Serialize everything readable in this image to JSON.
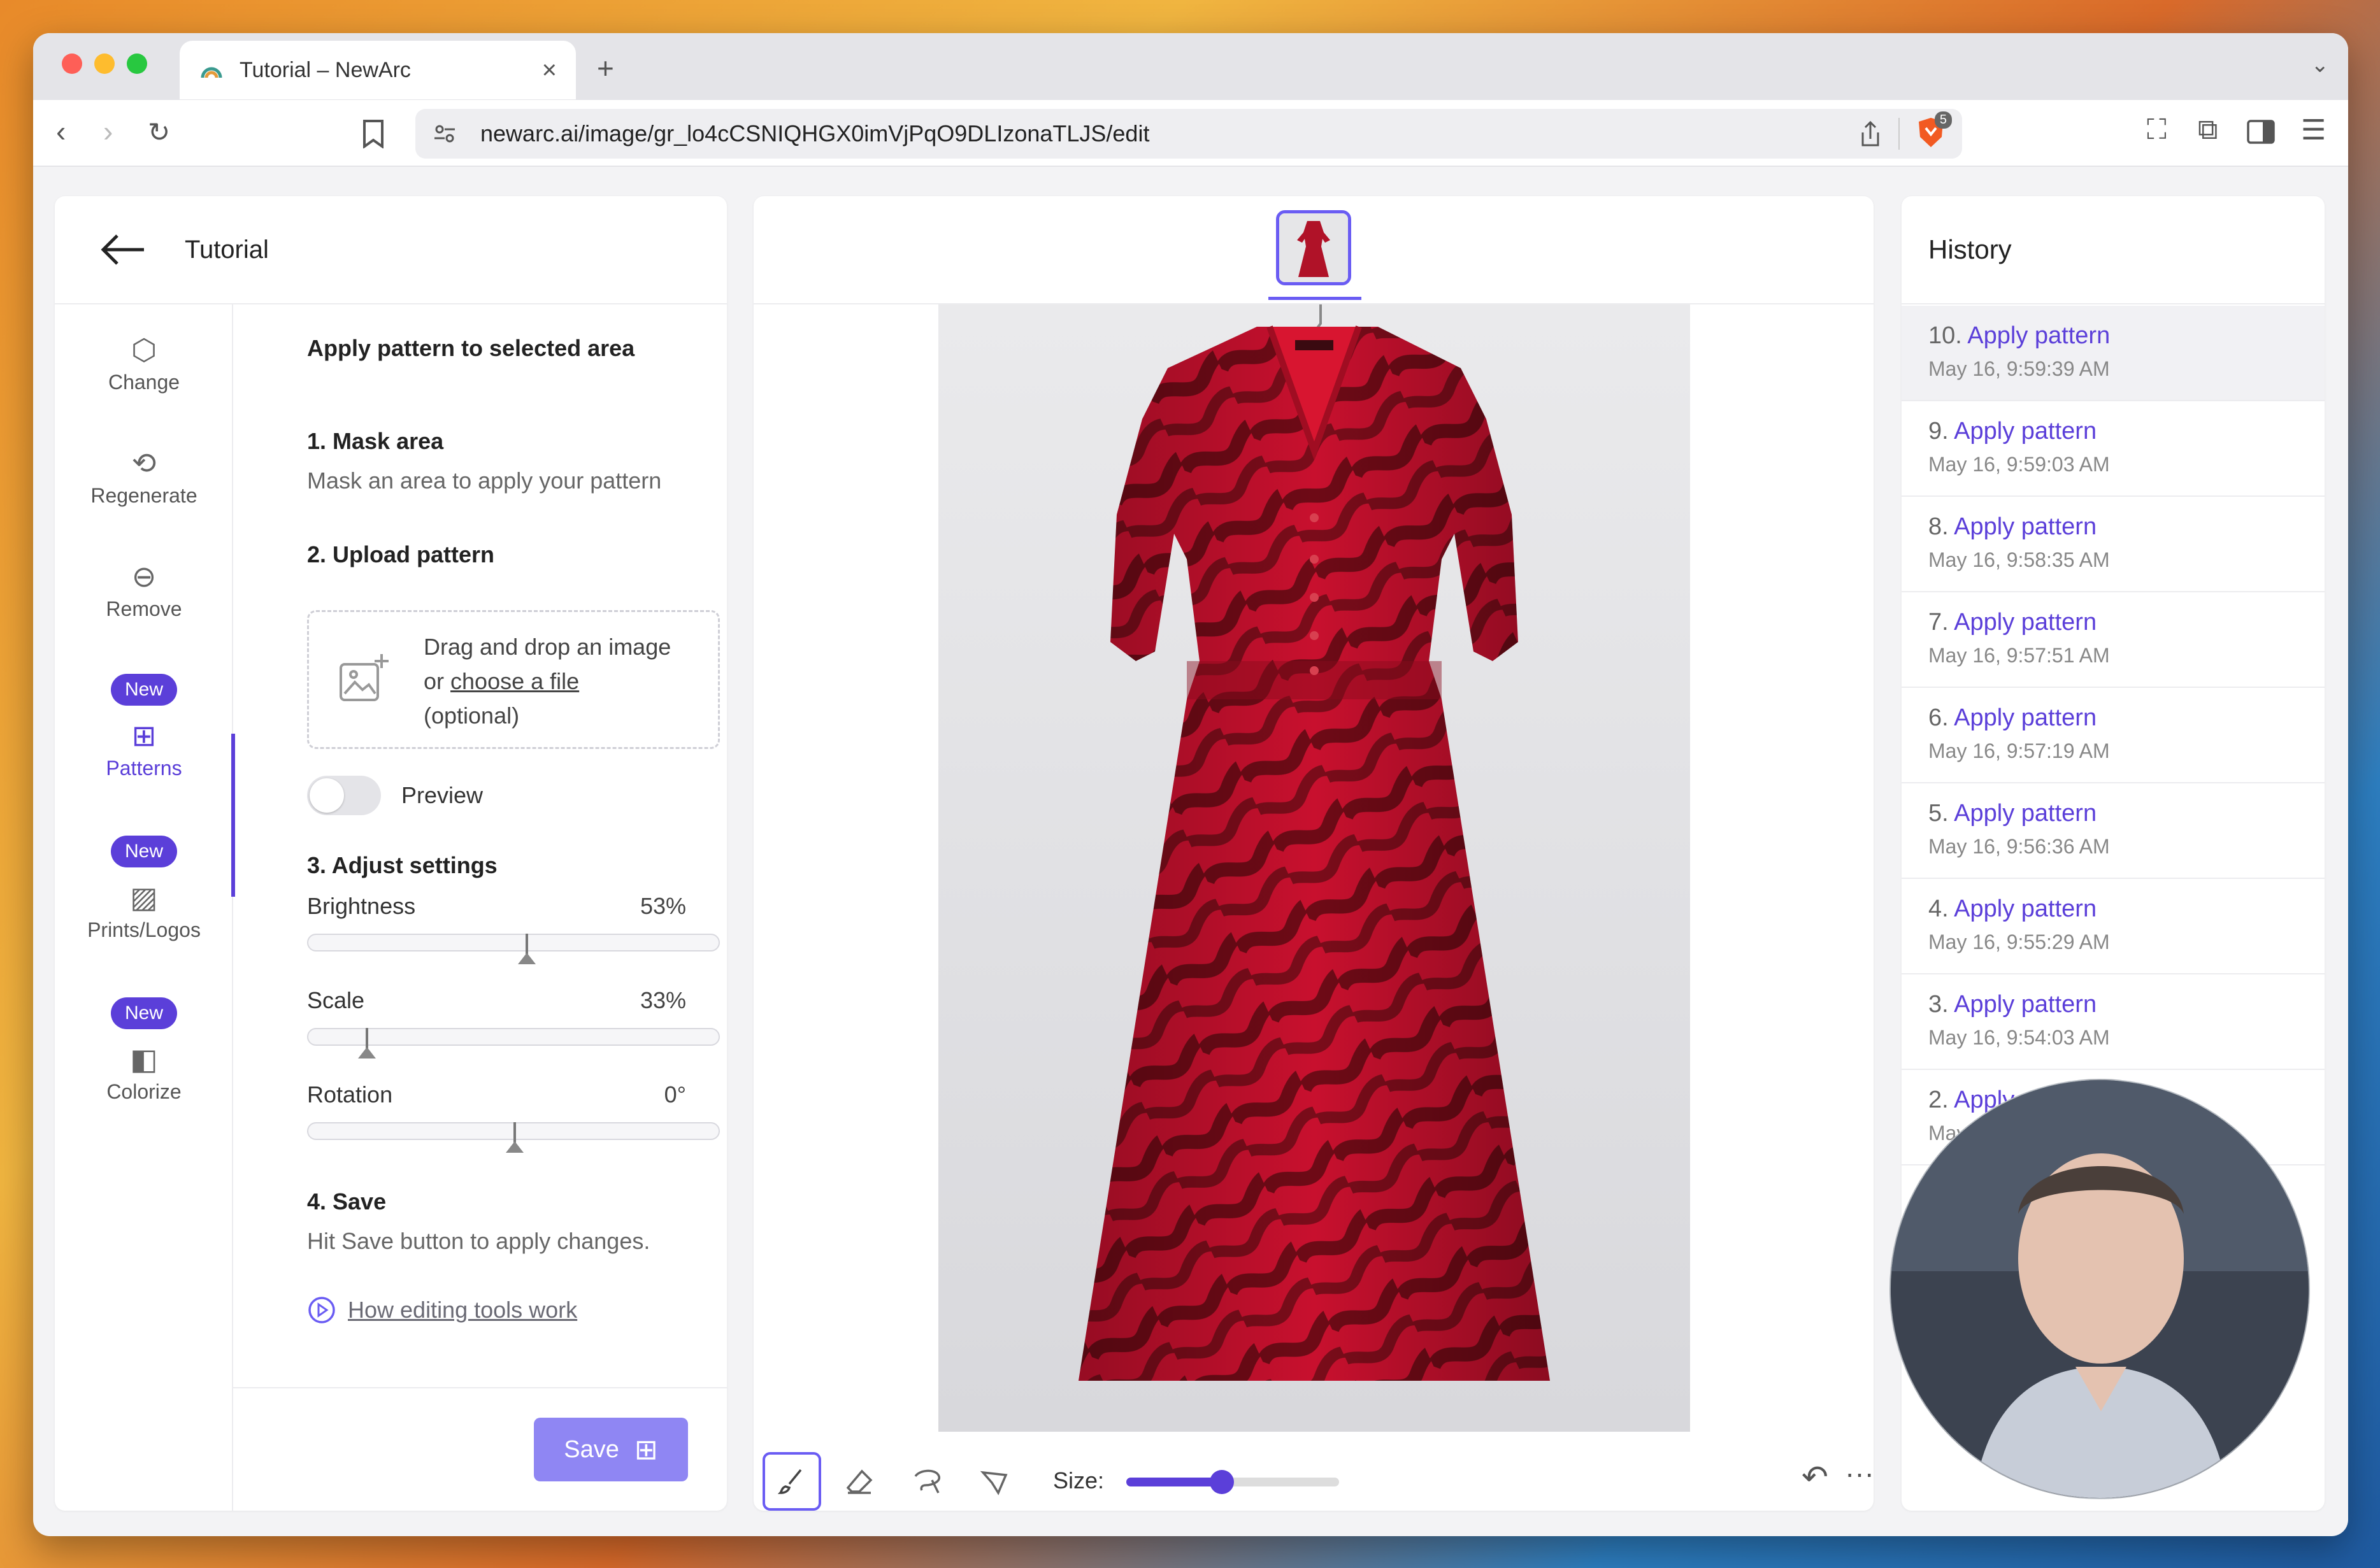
{
  "browser": {
    "tab_title": "Tutorial – NewArc",
    "tab_close": "×",
    "new_tab": "+",
    "url": "newarc.ai/image/gr_lo4cCSNIQHGX0imVjPqO9DLIzonaTLJS/edit",
    "brave_badge": "5"
  },
  "left_panel": {
    "back_label": "Tutorial",
    "rail": [
      {
        "label": "Change",
        "icon": "cube-icon"
      },
      {
        "label": "Regenerate",
        "icon": "refresh-icon"
      },
      {
        "label": "Remove",
        "icon": "minus-circle-icon"
      },
      {
        "label": "Patterns",
        "icon": "grid-icon",
        "badge": "New",
        "active": true
      },
      {
        "label": "Prints/Logos",
        "icon": "image-icon",
        "badge": "New"
      },
      {
        "label": "Colorize",
        "icon": "palette-icon",
        "badge": "New"
      }
    ],
    "heading": "Apply pattern to selected area",
    "step1_title": "1. Mask area",
    "step1_text": "Mask an area to apply your pattern",
    "step2_title": "2. Upload pattern",
    "drop_line1": "Drag and drop an image",
    "drop_or": "or",
    "drop_link": "choose a file",
    "drop_optional": "(optional)",
    "preview_label": "Preview",
    "preview_on": false,
    "step3_title": "3. Adjust settings",
    "sliders": [
      {
        "label": "Brightness",
        "value_text": "53%",
        "value": 0.53
      },
      {
        "label": "Scale",
        "value_text": "33%",
        "value": 0.14
      },
      {
        "label": "Rotation",
        "value_text": "0°",
        "value": 0.5
      }
    ],
    "step4_title": "4. Save",
    "step4_text": "Hit Save button to apply changes.",
    "howto_link": "How editing tools work",
    "save_label": "Save"
  },
  "canvas": {
    "size_label": "Size:",
    "brush_size": 0.45
  },
  "history": {
    "title": "History",
    "items": [
      {
        "num": "10.",
        "action": "Apply pattern",
        "time": "May 16, 9:59:39 AM",
        "selected": true
      },
      {
        "num": "9.",
        "action": "Apply pattern",
        "time": "May 16, 9:59:03 AM"
      },
      {
        "num": "8.",
        "action": "Apply pattern",
        "time": "May 16, 9:58:35 AM"
      },
      {
        "num": "7.",
        "action": "Apply pattern",
        "time": "May 16, 9:57:51 AM"
      },
      {
        "num": "6.",
        "action": "Apply pattern",
        "time": "May 16, 9:57:19 AM"
      },
      {
        "num": "5.",
        "action": "Apply pattern",
        "time": "May 16, 9:56:36 AM"
      },
      {
        "num": "4.",
        "action": "Apply pattern",
        "time": "May 16, 9:55:29 AM"
      },
      {
        "num": "3.",
        "action": "Apply pattern",
        "time": "May 16, 9:54:03 AM"
      },
      {
        "num": "2.",
        "action": "Apply pattern",
        "time": "May 16, 9:53:12 AM"
      }
    ]
  },
  "colors": {
    "accent": "#5b3fd9",
    "save_button": "#8f86f3",
    "dress_red": "#c8102e",
    "dress_dark": "#6e0a16"
  }
}
